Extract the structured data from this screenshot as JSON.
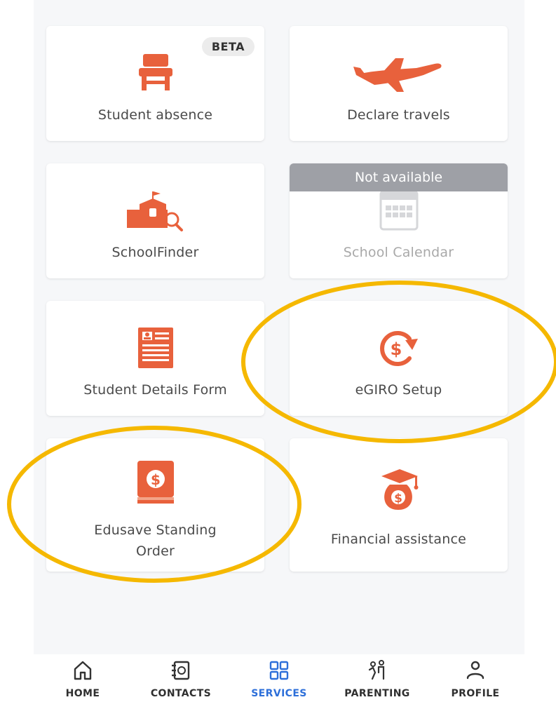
{
  "cards": [
    {
      "label": "Student absence",
      "badge": "BETA",
      "icon": "chair-icon"
    },
    {
      "label": "Declare travels",
      "icon": "airplane-icon"
    },
    {
      "label": "SchoolFinder",
      "icon": "school-search-icon"
    },
    {
      "label": "School Calendar",
      "banner": "Not available",
      "icon": "calendar-icon",
      "available": false
    },
    {
      "label": "Student Details Form",
      "icon": "id-form-icon"
    },
    {
      "label": "eGIRO Setup",
      "icon": "dollar-cycle-icon"
    },
    {
      "label_line1": "Edusave Standing",
      "label_line2": "Order",
      "icon": "dollar-book-icon"
    },
    {
      "label": "Financial assistance",
      "icon": "graduation-money-bag-icon"
    }
  ],
  "nav": [
    {
      "label": "HOME",
      "icon": "home-icon"
    },
    {
      "label": "CONTACTS",
      "icon": "contacts-icon"
    },
    {
      "label": "SERVICES",
      "icon": "grid-icon",
      "active": true
    },
    {
      "label": "PARENTING",
      "icon": "parenting-icon"
    },
    {
      "label": "PROFILE",
      "icon": "profile-icon"
    }
  ],
  "colors": {
    "accent": "#e8613c",
    "active_nav": "#2d6fd9",
    "highlight": "#f5b800",
    "banner": "#9ea0a6"
  }
}
